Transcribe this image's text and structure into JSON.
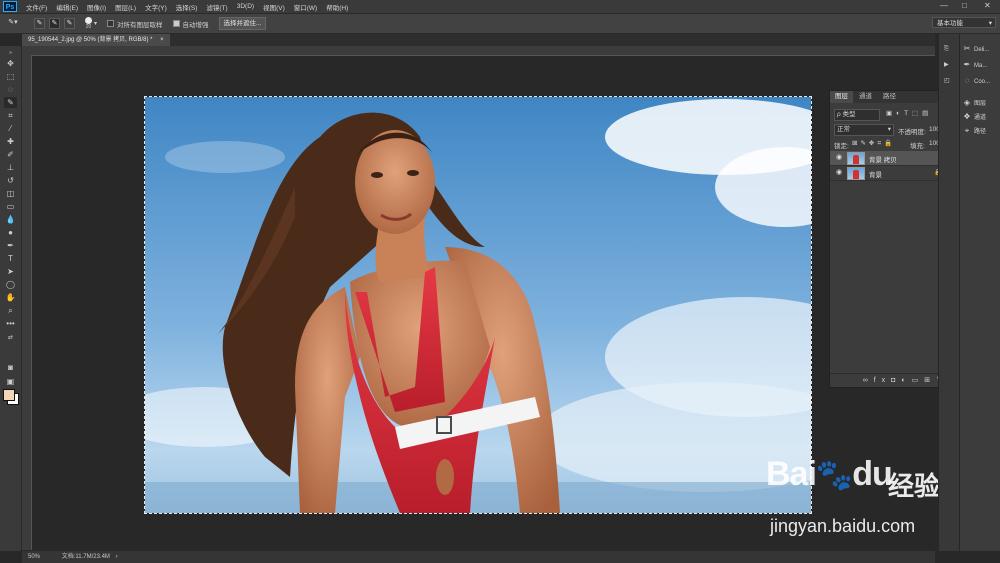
{
  "app": {
    "logo": "Ps"
  },
  "menu": [
    "文件(F)",
    "编辑(E)",
    "图像(I)",
    "图层(L)",
    "文字(Y)",
    "选择(S)",
    "滤镜(T)",
    "3D(D)",
    "视图(V)",
    "窗口(W)",
    "帮助(H)"
  ],
  "window_controls": {
    "minimize": "—",
    "maximize": "□",
    "close": "✕"
  },
  "options": {
    "brush_size": "20",
    "sample_all_layers": "对所有图层取样",
    "auto_enhance": "自动增强",
    "select_and_mask": "选择并遮住...",
    "workspace": "基本功能"
  },
  "document_tab": {
    "title": "95_190544_2.jpg @ 50% (背景 拷贝, RGB/8) *",
    "close": "×"
  },
  "status": {
    "zoom": "50%",
    "doc_size": "文档:11.7M/23.4M"
  },
  "layers_panel": {
    "tabs": [
      "图层",
      "通道",
      "路径"
    ],
    "filter_kind": "ρ 类型",
    "blend_mode": "正常",
    "opacity_label": "不透明度:",
    "opacity_value": "100%",
    "lock_label": "锁定:",
    "fill_label": "填充:",
    "fill_value": "100%",
    "layers": [
      {
        "name": "背景 拷贝",
        "selected": true,
        "locked": false
      },
      {
        "name": "背景",
        "selected": false,
        "locked": true
      }
    ]
  },
  "right_panels": [
    {
      "label": "图层",
      "icon": "layers-icon"
    },
    {
      "label": "通道",
      "icon": "channels-icon"
    },
    {
      "label": "路径",
      "icon": "paths-icon"
    }
  ],
  "right_tools": [
    {
      "label": "Deli...",
      "icon": "scissors-icon"
    },
    {
      "label": "Ma...",
      "icon": "pen-icon"
    },
    {
      "label": "Coo...",
      "icon": "cookie-icon"
    }
  ],
  "watermark": {
    "brand": "Bai",
    "brand2": "du",
    "cn": "经验",
    "url": "jingyan.baidu.com"
  },
  "colors": {
    "foreground": "#f2d6b6",
    "background": "#ffffff",
    "accent": "#31a8ff"
  }
}
